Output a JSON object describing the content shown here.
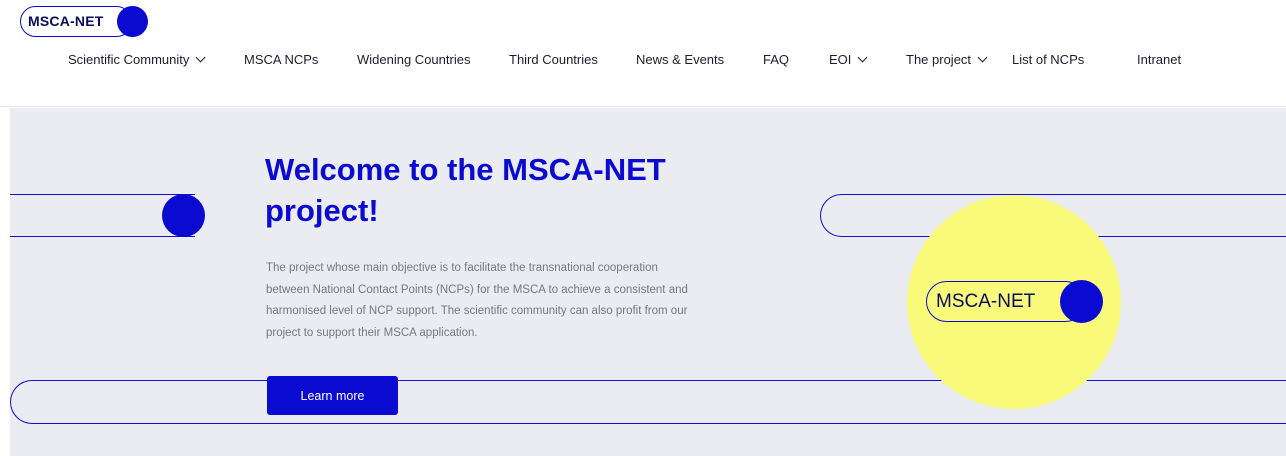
{
  "header": {
    "logo_text": "MSCA-NET",
    "nav": [
      {
        "label": "Scientific Community",
        "dropdown": true
      },
      {
        "label": "MSCA NCPs",
        "dropdown": false
      },
      {
        "label": "Widening Countries",
        "dropdown": false
      },
      {
        "label": "Third Countries",
        "dropdown": false
      },
      {
        "label": "News & Events",
        "dropdown": false
      },
      {
        "label": "FAQ",
        "dropdown": false
      },
      {
        "label": "EOI",
        "dropdown": true
      },
      {
        "label": "The project",
        "dropdown": true
      },
      {
        "label": "List of NCPs",
        "dropdown": false
      },
      {
        "label": "Intranet",
        "dropdown": false
      }
    ]
  },
  "hero": {
    "title": "Welcome to the MSCA-NET project!",
    "description": "The project whose main objective is to facilitate the transnational cooperation between National Contact Points (NCPs) for the MSCA to achieve a consistent and harmonised level of NCP support. The scientific community can also profit from our project to support their MSCA application.",
    "button_label": "Learn more",
    "badge_text": "MSCA-NET"
  },
  "colors": {
    "brand_blue": "#0a0ad0",
    "highlight_yellow": "#fafa7a",
    "hero_background": "#ebebf2"
  }
}
